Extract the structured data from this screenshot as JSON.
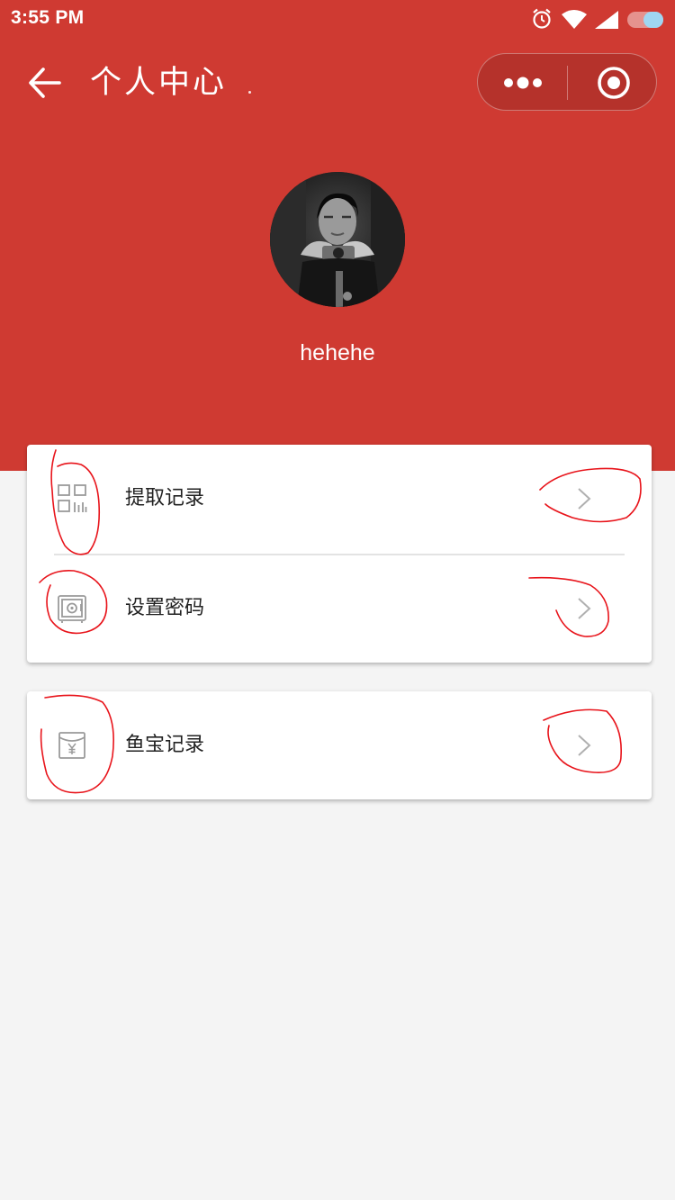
{
  "status_bar": {
    "time": "3:55 PM",
    "icons": [
      "alarm-icon",
      "wifi-icon",
      "signal-icon",
      "battery-icon"
    ]
  },
  "nav": {
    "back_icon": "arrow-left-icon",
    "title": "个人中心",
    "capsule": {
      "more_icon": "more-dots-icon",
      "close_icon": "target-close-icon"
    }
  },
  "profile": {
    "avatar": "avatar-photo",
    "username": "hehehe"
  },
  "menu": {
    "group1": [
      {
        "label": "提取记录",
        "icon": "qrcode-icon"
      },
      {
        "label": "设置密码",
        "icon": "safe-icon"
      }
    ],
    "group2": [
      {
        "label": "鱼宝记录",
        "icon": "red-envelope-yen-icon"
      }
    ],
    "chevron_icon": "chevron-right-icon"
  },
  "colors": {
    "header_bg": "#cf3a32",
    "page_bg": "#f4f4f4",
    "card_bg": "#ffffff",
    "annotation": "#e8141b"
  }
}
